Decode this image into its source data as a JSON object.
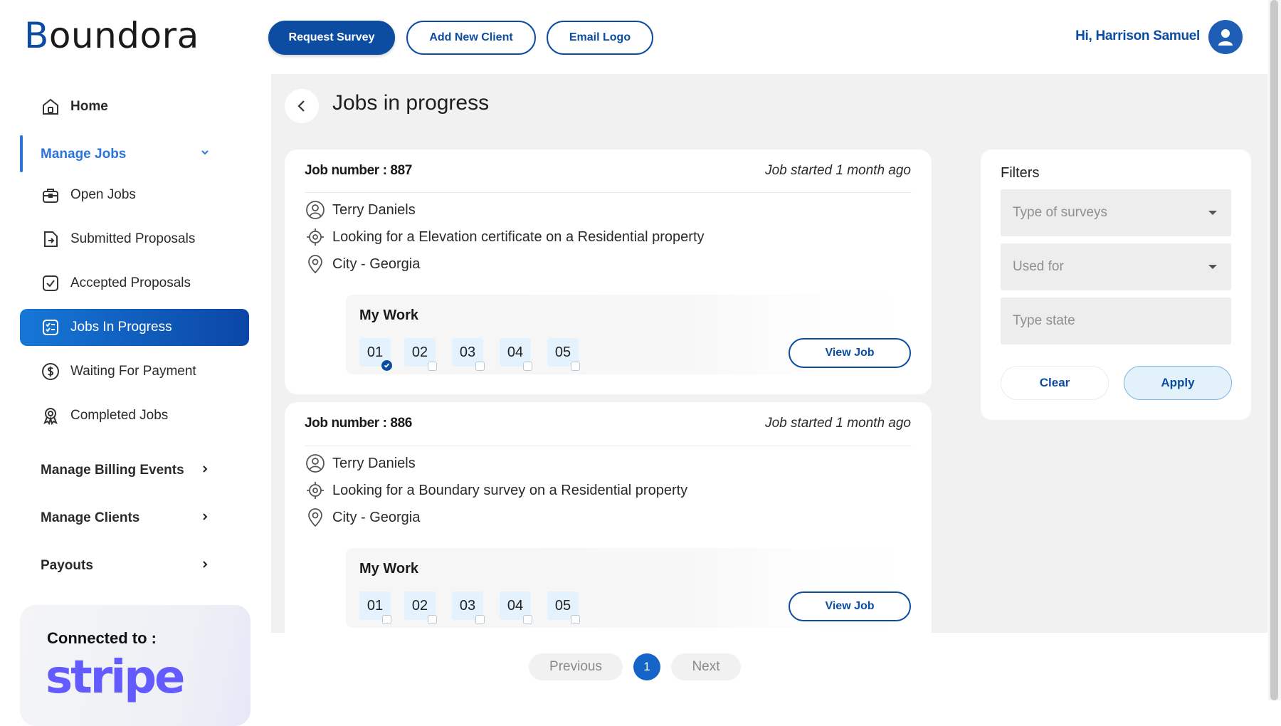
{
  "brand": {
    "name": "oundora",
    "initial": "B"
  },
  "header": {
    "request_survey": "Request Survey",
    "add_new_client": "Add New Client",
    "email_logo": "Email Logo",
    "greeting": "Hi, Harrison Samuel"
  },
  "sidebar": {
    "home": "Home",
    "manage_jobs": "Manage Jobs",
    "items": [
      {
        "label": "Open Jobs",
        "icon": "briefcase-icon"
      },
      {
        "label": "Submitted Proposals",
        "icon": "file-arrow-icon"
      },
      {
        "label": "Accepted Proposals",
        "icon": "check-square-icon"
      },
      {
        "label": "Jobs In Progress",
        "icon": "checklist-icon",
        "active": true
      },
      {
        "label": "Waiting For Payment",
        "icon": "dollar-icon"
      },
      {
        "label": "Completed Jobs",
        "icon": "award-icon"
      }
    ],
    "manage_billing_events": "Manage Billing Events",
    "manage_clients": "Manage Clients",
    "payouts": "Payouts",
    "connected_to": "Connected to :",
    "stripe": "stripe"
  },
  "page": {
    "title": "Jobs in progress"
  },
  "jobs": [
    {
      "number": "Job number : 887",
      "started": "Job started 1 month ago",
      "client": "Terry Daniels",
      "description": "Looking for a Elevation certificate on a Residential property",
      "location": "City - Georgia",
      "my_work": "My Work",
      "steps": [
        "01",
        "02",
        "03",
        "04",
        "05"
      ],
      "completed_steps": 1,
      "view_job": "View Job"
    },
    {
      "number": "Job number : 886",
      "started": "Job started 1 month ago",
      "client": "Terry Daniels",
      "description": "Looking for a Boundary survey on a Residential property",
      "location": "City - Georgia",
      "my_work": "My Work",
      "steps": [
        "01",
        "02",
        "03",
        "04",
        "05"
      ],
      "completed_steps": 0,
      "view_job": "View Job"
    }
  ],
  "pagination": {
    "previous": "Previous",
    "current": "1",
    "next": "Next"
  },
  "filters": {
    "title": "Filters",
    "type_of_surveys": "Type of surveys",
    "used_for": "Used for",
    "type_state": "Type state",
    "clear": "Clear",
    "apply": "Apply"
  },
  "colors": {
    "brand_blue": "#0c4da2",
    "accent_blue": "#2c74d8",
    "stripe_purple": "#635bff"
  }
}
